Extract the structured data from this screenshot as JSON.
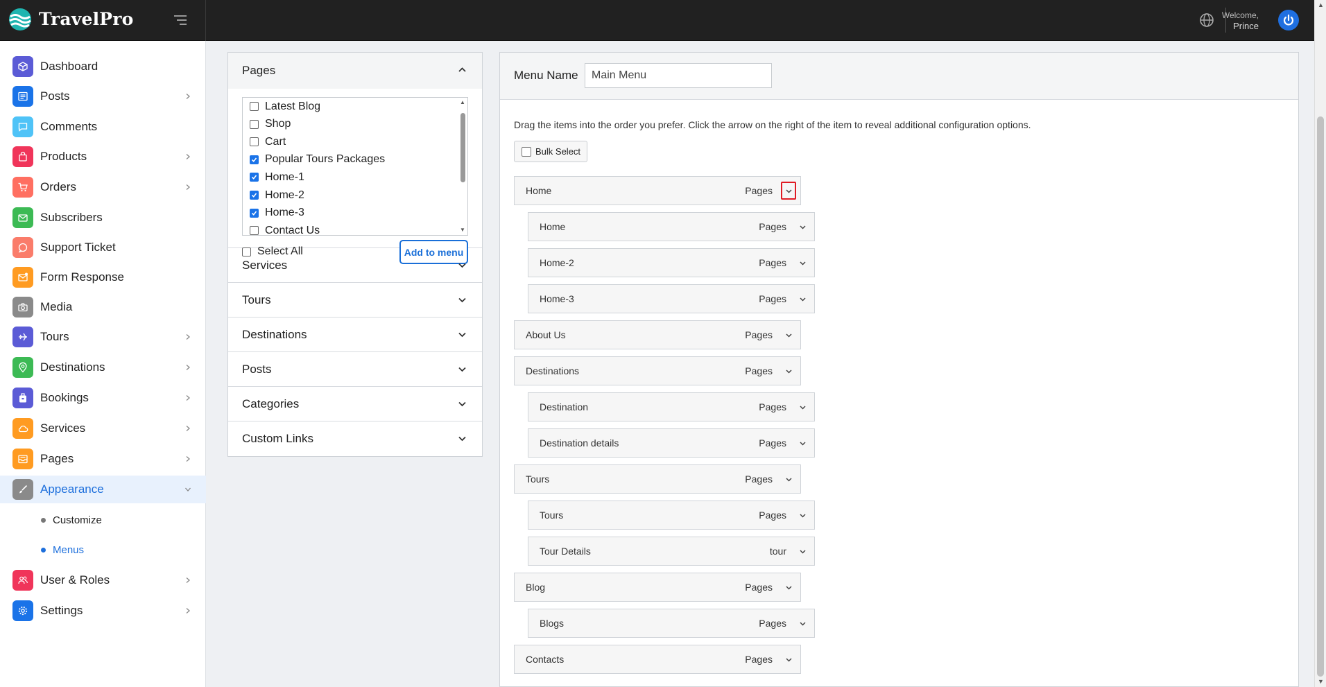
{
  "app": {
    "brand": "TravelPro"
  },
  "header": {
    "welcome": "Welcome,",
    "user": "Prince"
  },
  "sidebar": {
    "items": [
      {
        "label": "Dashboard",
        "icon": "cube-icon",
        "color": "#5b5bd6",
        "chev": false
      },
      {
        "label": "Posts",
        "icon": "newspaper-icon",
        "color": "#1a73e8",
        "chev": true
      },
      {
        "label": "Comments",
        "icon": "chat-icon",
        "color": "#4fc3f7",
        "chev": false
      },
      {
        "label": "Products",
        "icon": "bag-icon",
        "color": "#f0355a",
        "chev": true
      },
      {
        "label": "Orders",
        "icon": "cart-icon",
        "color": "#ff6f61",
        "chev": true
      },
      {
        "label": "Subscribers",
        "icon": "mail-icon",
        "color": "#3cba54",
        "chev": false
      },
      {
        "label": "Support Ticket",
        "icon": "support-icon",
        "color": "#fa7c6a",
        "chev": false
      },
      {
        "label": "Form Response",
        "icon": "envelope-icon",
        "color": "#ff9b21",
        "chev": false
      },
      {
        "label": "Media",
        "icon": "camera-icon",
        "color": "#8a8a8a",
        "chev": false
      },
      {
        "label": "Tours",
        "icon": "plane-icon",
        "color": "#5b5bd6",
        "chev": true
      },
      {
        "label": "Destinations",
        "icon": "pin-icon",
        "color": "#3cba54",
        "chev": true
      },
      {
        "label": "Bookings",
        "icon": "suitcase-icon",
        "color": "#5b5bd6",
        "chev": true
      },
      {
        "label": "Services",
        "icon": "cloud-icon",
        "color": "#ff9b21",
        "chev": true
      },
      {
        "label": "Pages",
        "icon": "inbox-icon",
        "color": "#ff9b21",
        "chev": true
      },
      {
        "label": "Appearance",
        "icon": "brush-icon",
        "color": "#8a8a8a",
        "chev": true
      },
      {
        "label": "User & Roles",
        "icon": "users-icon",
        "color": "#f0355a",
        "chev": true
      },
      {
        "label": "Settings",
        "icon": "gear-icon",
        "color": "#1a73e8",
        "chev": true
      }
    ],
    "sub": [
      {
        "label": "Customize"
      },
      {
        "label": "Menus"
      }
    ]
  },
  "accordion": {
    "pages_title": "Pages",
    "pages": [
      {
        "label": "Latest Blog",
        "checked": false
      },
      {
        "label": "Shop",
        "checked": false
      },
      {
        "label": "Cart",
        "checked": false
      },
      {
        "label": "Popular Tours Packages",
        "checked": true
      },
      {
        "label": "Home-1",
        "checked": true
      },
      {
        "label": "Home-2",
        "checked": true
      },
      {
        "label": "Home-3",
        "checked": true
      },
      {
        "label": "Contact Us",
        "checked": false
      }
    ],
    "select_all": "Select All",
    "add_button": "Add to menu",
    "sections": [
      "Services",
      "Tours",
      "Destinations",
      "Posts",
      "Categories",
      "Custom Links"
    ]
  },
  "menu": {
    "name_label": "Menu Name",
    "name_value": "Main Menu",
    "instructions": "Drag the items into the order you prefer. Click the arrow on the right of the item to reveal additional configuration options.",
    "bulk_select": "Bulk Select",
    "items": [
      {
        "title": "Home",
        "type": "Pages",
        "level": 0,
        "highlight": true
      },
      {
        "title": "Home",
        "type": "Pages",
        "level": 1
      },
      {
        "title": "Home-2",
        "type": "Pages",
        "level": 1
      },
      {
        "title": "Home-3",
        "type": "Pages",
        "level": 1
      },
      {
        "title": "About Us",
        "type": "Pages",
        "level": 0
      },
      {
        "title": "Destinations",
        "type": "Pages",
        "level": 0
      },
      {
        "title": "Destination",
        "type": "Pages",
        "level": 1
      },
      {
        "title": "Destination details",
        "type": "Pages",
        "level": 1
      },
      {
        "title": "Tours",
        "type": "Pages",
        "level": 0
      },
      {
        "title": "Tours",
        "type": "Pages",
        "level": 1
      },
      {
        "title": "Tour Details",
        "type": "tour",
        "level": 1
      },
      {
        "title": "Blog",
        "type": "Pages",
        "level": 0
      },
      {
        "title": "Blogs",
        "type": "Pages",
        "level": 1
      },
      {
        "title": "Contacts",
        "type": "Pages",
        "level": 0
      }
    ]
  }
}
